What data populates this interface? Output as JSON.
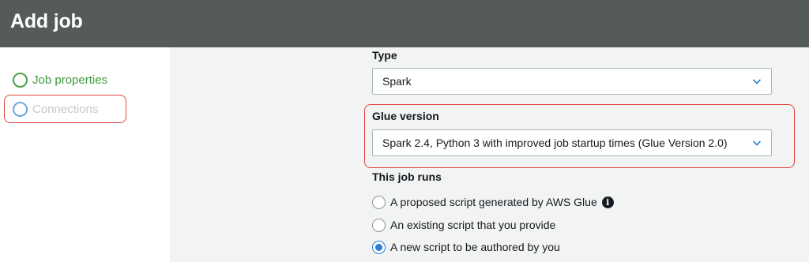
{
  "header": {
    "title": "Add job"
  },
  "sidebar": {
    "steps": [
      {
        "label": "Job properties",
        "state": "active"
      },
      {
        "label": "Connections",
        "state": "pending"
      }
    ]
  },
  "form": {
    "type": {
      "label": "Type",
      "value": "Spark"
    },
    "glue_version": {
      "label": "Glue version",
      "value": "Spark 2.4, Python 3 with improved job startup times (Glue Version 2.0)"
    },
    "job_runs": {
      "label": "This job runs",
      "options": [
        {
          "label": "A proposed script generated by AWS Glue",
          "selected": false,
          "icon": "info-icon"
        },
        {
          "label": "An existing script that you provide",
          "selected": false
        },
        {
          "label": "A new script to be authored by you",
          "selected": true
        }
      ]
    }
  },
  "colors": {
    "header_bg": "#545b5a",
    "active_step": "#3d9a3f",
    "highlight": "#e0443e",
    "radio_selected": "#2a7fd6"
  }
}
